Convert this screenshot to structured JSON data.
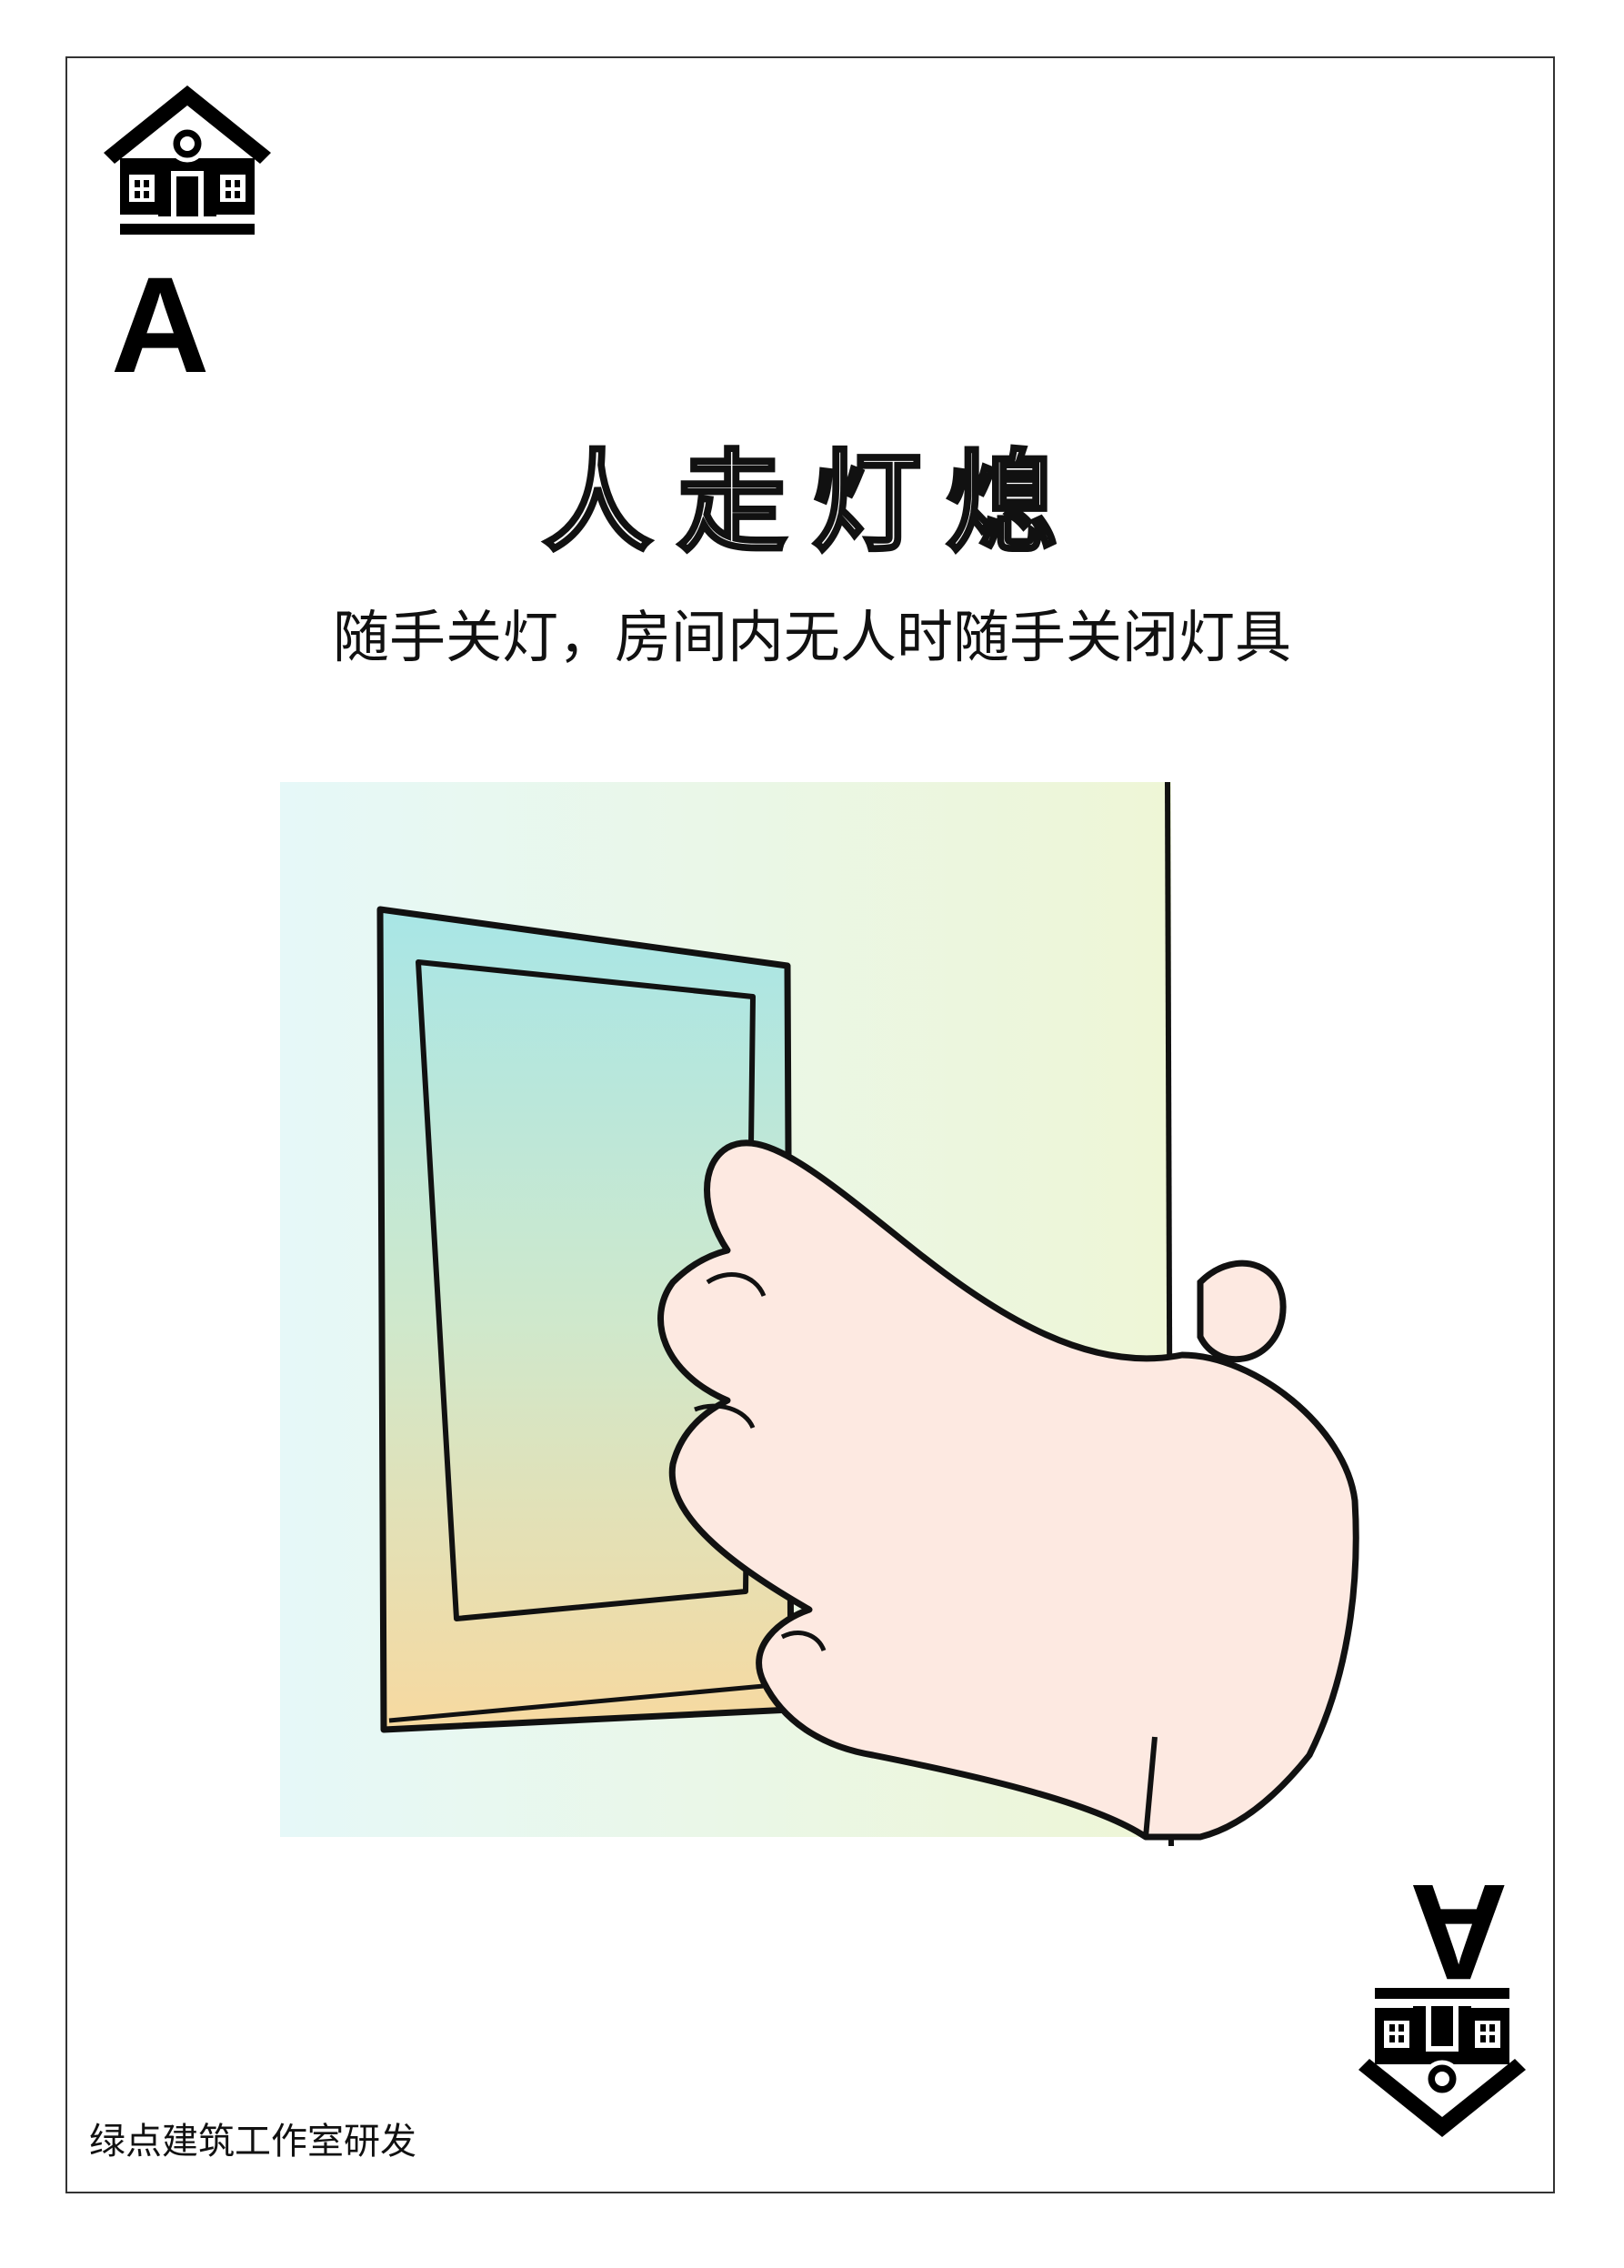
{
  "card": {
    "rank": "A",
    "title": "人走灯熄",
    "subtitle": "随手关灯，房间内无人时随手关闭灯具",
    "footer": "绿点建筑工作室研发",
    "corner_icon": "house-icon"
  },
  "colors": {
    "wall_gradient_left": "#e6f8f8",
    "wall_gradient_right": "#eef6d6",
    "switch_top": "#a8e6e6",
    "switch_bottom": "#f7d9a0",
    "hand": "#fde9e1",
    "outline": "#111111"
  }
}
